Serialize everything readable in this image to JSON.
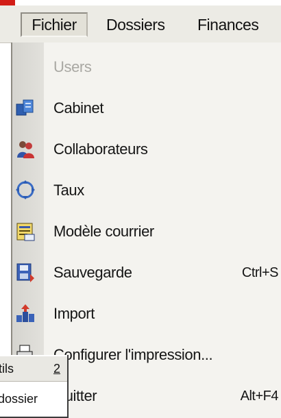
{
  "menubar": {
    "items": [
      {
        "label": "Fichier",
        "active": true
      },
      {
        "label": "Dossiers"
      },
      {
        "label": "Finances"
      }
    ]
  },
  "menu": {
    "items": [
      {
        "label": "Users",
        "disabled": true,
        "icon": "none"
      },
      {
        "label": "Cabinet",
        "icon": "cabinet-icon"
      },
      {
        "label": "Collaborateurs",
        "icon": "collaborators-icon"
      },
      {
        "label": "Taux",
        "icon": "rates-icon"
      },
      {
        "label": "Modèle courrier",
        "icon": "letter-template-icon"
      },
      {
        "label": "Sauvegarde",
        "shortcut": "Ctrl+S",
        "icon": "backup-icon"
      },
      {
        "label": "Import",
        "icon": "import-icon"
      },
      {
        "label": "Configurer l'impression...",
        "icon": "print-setup-icon"
      },
      {
        "label": "Quitter",
        "shortcut": "Alt+F4",
        "icon": "none"
      }
    ]
  },
  "overlap": {
    "row1_text": "tils",
    "row1_num": "2",
    "row2_text": "dossier"
  },
  "colors": {
    "accent_red": "#d21d16",
    "menu_bg": "#f4f3ef",
    "menubar_bg": "#ecebe5",
    "disabled_text": "#a9a8a3"
  }
}
